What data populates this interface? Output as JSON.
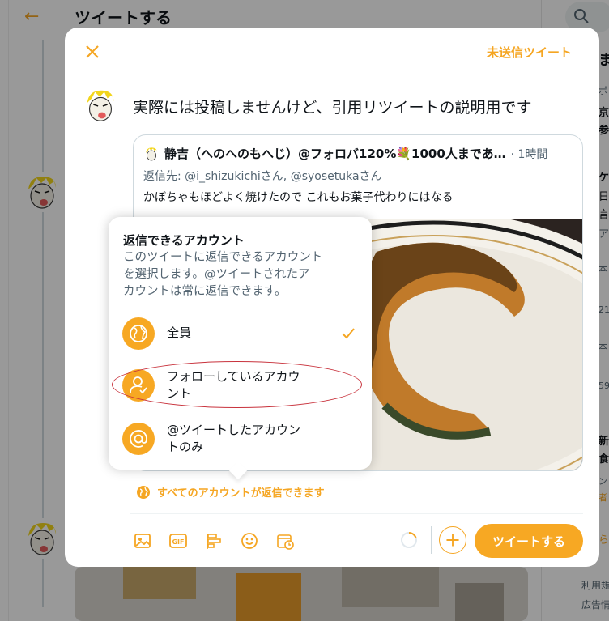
{
  "background": {
    "header_title": "ツイートする",
    "right_column_fragments": [
      "ま",
      "ポ",
      "京",
      "参",
      "ケ",
      "日",
      "言",
      "ア",
      "本",
      "21",
      "本",
      "59",
      "新",
      "食",
      "ン",
      "者",
      "ら"
    ],
    "footer_lines": [
      "利用規",
      "広告情"
    ]
  },
  "modal": {
    "drafts_label": "未送信ツイート",
    "compose_text": "実際には投稿しませんけど、引用リツイートの説明用です",
    "quoted_tweet": {
      "author_name": "静吉（へのへのもへじ）@フォロバ120%💐1000人まであ…",
      "time": "· 1時間",
      "reply_prefix": "返信先: ",
      "reply_user1": "@i_shizukichiさん",
      "reply_user2": "@syosetukaさん",
      "reply_sep": ", ",
      "text": "かぼちゃもほどよく焼けたので これもお菓子代わりにはなる"
    },
    "reply_setting_label": "すべてのアカウントが返信できます",
    "tweet_button_label": "ツイートする",
    "toolbar_icons": [
      "image-icon",
      "gif-icon",
      "poll-icon",
      "emoji-icon",
      "schedule-icon"
    ]
  },
  "popup": {
    "title": "返信できるアカウント",
    "description_lines": [
      "このツイートに返信できるアカウント",
      "を選択します。@ツイートされたア",
      "カウントは常に返信できます。"
    ],
    "options": [
      {
        "lines": [
          "全員"
        ],
        "icon": "globe-icon",
        "selected": true
      },
      {
        "lines": [
          "フォローしているアカウ",
          "ント"
        ],
        "icon": "person-check-icon",
        "selected": false
      },
      {
        "lines": [
          "@ツイートしたアカウン",
          "トのみ"
        ],
        "icon": "at-icon",
        "selected": false
      }
    ]
  },
  "colors": {
    "accent": "#f7a823",
    "accent_text": "#f5a623",
    "highlight_outline": "#c8323c"
  }
}
